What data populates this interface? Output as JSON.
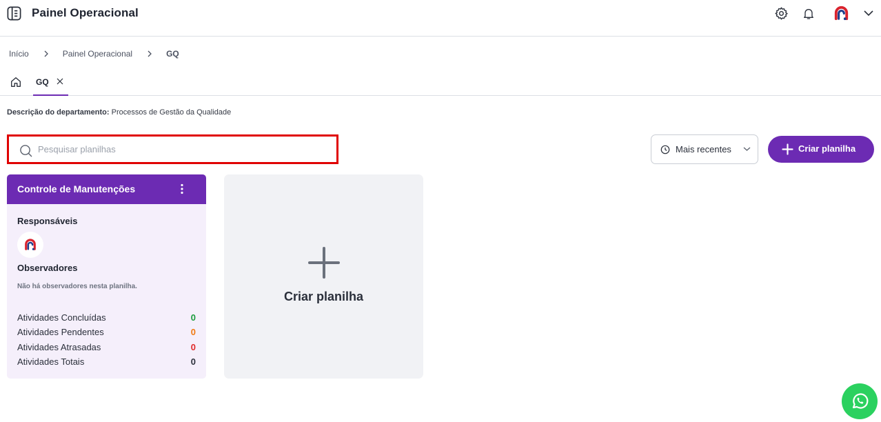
{
  "header": {
    "title": "Painel Operacional",
    "icons": [
      "menu-book-icon",
      "gear-icon",
      "bell-icon",
      "brand-logo-avatar",
      "chevron-down-icon"
    ]
  },
  "breadcrumb": {
    "items": [
      "Início",
      "Painel Operacional",
      "GQ"
    ]
  },
  "tabs": {
    "home_icon": "home-icon",
    "active_tab": "GQ",
    "close_icon": "close-icon"
  },
  "department": {
    "label": "Descrição do departamento:",
    "value": "Processos de Gestão da Qualidade"
  },
  "toolbar": {
    "search_placeholder": "Pesquisar planilhas",
    "sort_label": "Mais recentes",
    "create_label": "Criar planilha"
  },
  "spreadsheet_card": {
    "title": "Controle de Manutenções",
    "responsible_label": "Responsáveis",
    "observers_label": "Observadores",
    "observers_empty": "Não há observadores nesta planilha.",
    "stats": [
      {
        "label": "Atividades Concluídas",
        "value": "0",
        "color": "#1a9b3c"
      },
      {
        "label": "Atividades Pendentes",
        "value": "0",
        "color": "#f07a12"
      },
      {
        "label": "Atividades Atrasadas",
        "value": "0",
        "color": "#e02a2a"
      },
      {
        "label": "Atividades Totais",
        "value": "0",
        "color": "#2a2f3a"
      }
    ]
  },
  "new_card": {
    "label": "Criar planilha"
  },
  "colors": {
    "accent": "#6c2bb3",
    "highlight_border": "#e00000",
    "whatsapp": "#2bd15f"
  }
}
